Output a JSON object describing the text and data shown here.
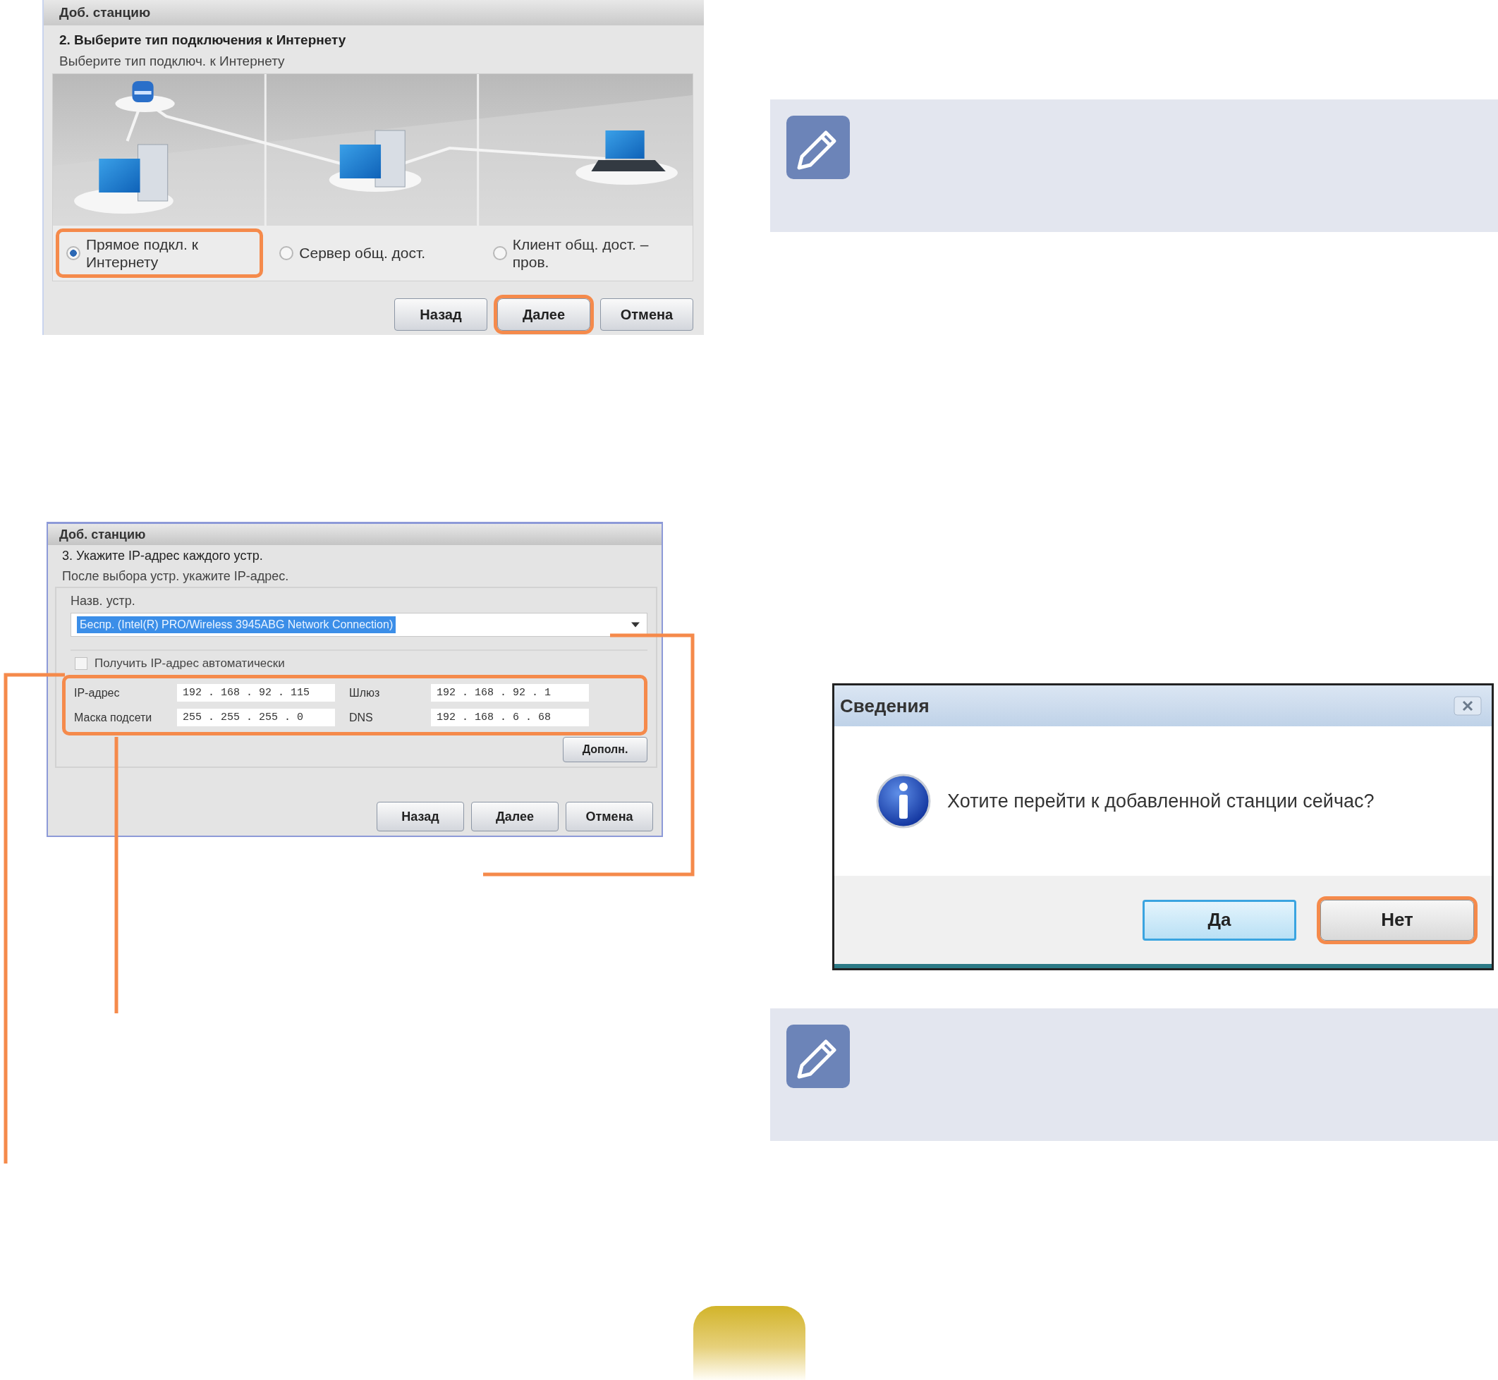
{
  "dialog_connection": {
    "title": "Доб. станцию",
    "heading": "2. Выберите тип подключения к Интернету",
    "subheading": "Выберите тип подключ. к Интернету",
    "options": [
      {
        "label": "Прямое подкл. к Интернету",
        "selected": true,
        "highlighted": true
      },
      {
        "label": "Сервер общ. дост.",
        "selected": false,
        "highlighted": false
      },
      {
        "label": "Клиент общ. дост. – пров.",
        "selected": false,
        "highlighted": false
      }
    ],
    "buttons": [
      {
        "label": "Назад",
        "highlighted": false
      },
      {
        "label": "Далее",
        "highlighted": true
      },
      {
        "label": "Отмена",
        "highlighted": false
      }
    ]
  },
  "dialog_ip": {
    "title": "Доб. станцию",
    "heading": "3. Укажите IP-адрес каждого устр.",
    "subheading": "После выбора устр. укажите IP-адрес.",
    "device_label": "Назв. устр.",
    "device_value": "Беспр. (Intel(R) PRO/Wireless 3945ABG Network Connection)",
    "auto_checkbox": {
      "label": "Получить IP-адрес автоматически",
      "checked": false
    },
    "fields_highlighted": true,
    "fields": [
      {
        "label": "IP-адрес",
        "value": "192 . 168 . 92 . 115"
      },
      {
        "label": "Шлюз",
        "value": "192 . 168 . 92 . 1"
      },
      {
        "label": "Маска подсети",
        "value": "255 . 255 . 255 . 0"
      },
      {
        "label": "DNS",
        "value": "192 . 168 . 6 . 68"
      }
    ],
    "advanced_button": "Дополн.",
    "buttons": [
      {
        "label": "Назад",
        "highlighted": false
      },
      {
        "label": "Далее",
        "highlighted": false
      },
      {
        "label": "Отмена",
        "highlighted": false
      }
    ]
  },
  "dialog_info": {
    "title": "Сведения",
    "message": "Хотите перейти к добавленной станции сейчас?",
    "buttons": [
      {
        "label": "Да",
        "default": true,
        "highlighted": false
      },
      {
        "label": "Нет",
        "default": false,
        "highlighted": true
      }
    ]
  }
}
